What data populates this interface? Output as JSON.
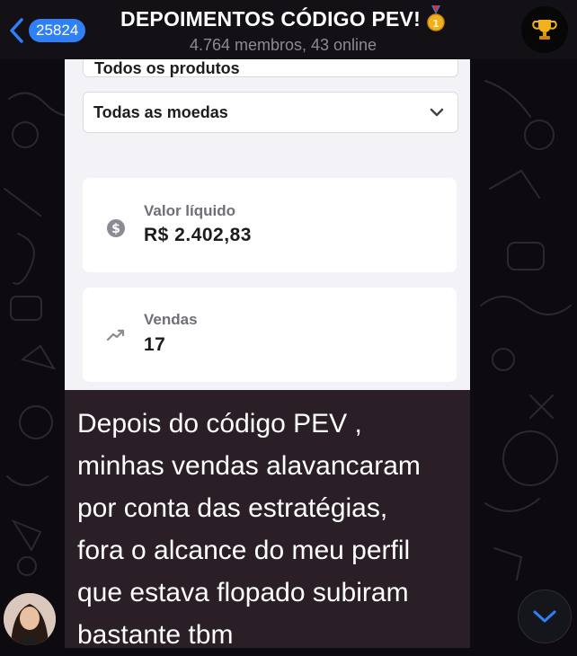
{
  "header": {
    "back_count": "25824",
    "title": "DEPOIMENTOS CÓDIGO PEV!",
    "subtitle": "4.764 membros, 43 online",
    "medal_icon": "gold-medal",
    "trophy_icon": "trophy"
  },
  "screenshot": {
    "product_filter": "Todos os produtos",
    "currency_filter": "Todas as moedas",
    "cards": [
      {
        "label": "Valor líquido",
        "value": "R$ 2.402,83",
        "icon": "dollar-circle-icon"
      },
      {
        "label": "Vendas",
        "value": "17",
        "icon": "trending-up-icon"
      }
    ]
  },
  "message": {
    "lines": [
      "Depois do código PEV ,",
      "minhas vendas alavancaram",
      "por conta das estratégias,",
      "fora o alcance do meu perfil",
      "que estava flopado subiram",
      "bastante tbm"
    ]
  },
  "colors": {
    "accent": "#2f7ff6",
    "header_bg": "#141116",
    "bubble_bg": "#2a1f27"
  }
}
